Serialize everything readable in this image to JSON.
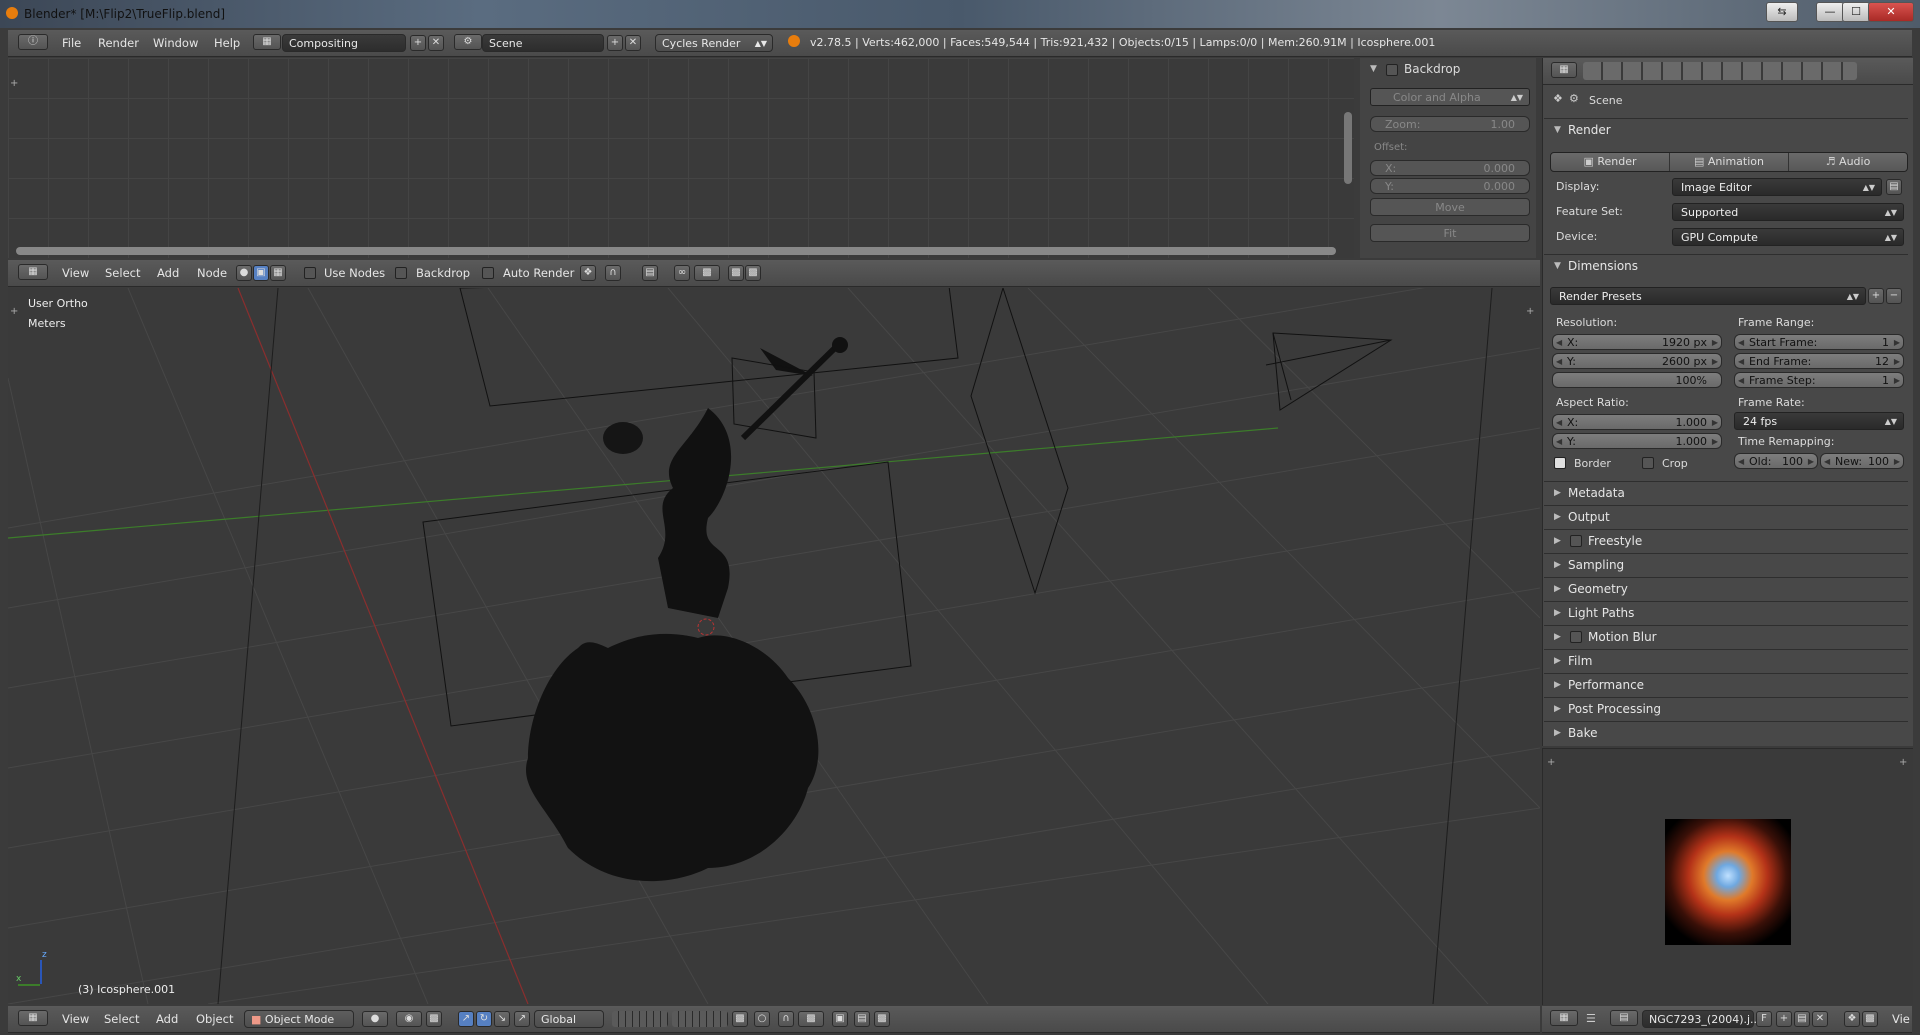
{
  "window": {
    "title": "Blender* [M:\\Flip2\\TrueFlip.blend]",
    "minimize": "—",
    "maximize": "☐",
    "close": "✕",
    "restore": "⇆"
  },
  "info_header": {
    "menus": [
      "File",
      "Render",
      "Window",
      "Help"
    ],
    "screen_layout": "Compositing",
    "scene": "Scene",
    "engine": "Cycles Render",
    "stats": "v2.78.5 | Verts:462,000 | Faces:549,544 | Tris:921,432 | Objects:0/15 | Lamps:0/0 | Mem:260.91M | Icosphere.001"
  },
  "node_sidebar": {
    "backdrop_title": "Backdrop",
    "channels": "Color and Alpha",
    "zoom_label": "Zoom:",
    "zoom_value": "1.00",
    "offset_label": "Offset:",
    "x_label": "X:",
    "x_value": "0.000",
    "y_label": "Y:",
    "y_value": "0.000",
    "move": "Move",
    "fit": "Fit"
  },
  "node_header": {
    "menus": [
      "View",
      "Select",
      "Add",
      "Node"
    ],
    "use_nodes": "Use Nodes",
    "backdrop": "Backdrop",
    "auto_render": "Auto Render"
  },
  "viewport": {
    "view_name": "User Ortho",
    "units": "Meters",
    "active_object": "(3) Icosphere.001",
    "axis_x": "x",
    "axis_z": "z"
  },
  "viewport_header": {
    "menus": [
      "View",
      "Select",
      "Add",
      "Object"
    ],
    "mode": "Object Mode",
    "orientation": "Global"
  },
  "properties": {
    "context": "Scene",
    "render_panel": "Render",
    "render_btn": "Render",
    "animation_btn": "Animation",
    "audio_btn": "Audio",
    "display_label": "Display:",
    "display_value": "Image Editor",
    "feature_label": "Feature Set:",
    "feature_value": "Supported",
    "device_label": "Device:",
    "device_value": "GPU Compute",
    "dimensions_panel": "Dimensions",
    "render_presets": "Render Presets",
    "resolution_label": "Resolution:",
    "res_x_label": "X:",
    "res_x": "1920 px",
    "res_y_label": "Y:",
    "res_y": "2600 px",
    "res_pct": "100%",
    "frame_range_label": "Frame Range:",
    "start_label": "Start Frame:",
    "start": "1",
    "end_label": "End Frame:",
    "end": "12",
    "step_label": "Frame Step:",
    "step": "1",
    "aspect_label": "Aspect Ratio:",
    "asp_x_label": "X:",
    "asp_x": "1.000",
    "asp_y_label": "Y:",
    "asp_y": "1.000",
    "frame_rate_label": "Frame Rate:",
    "frame_rate": "24 fps",
    "time_remap_label": "Time Remapping:",
    "old_label": "Old:",
    "old": "100",
    "new_label": "New:",
    "new": "100",
    "border": "Border",
    "crop": "Crop",
    "sections": [
      "Metadata",
      "Output",
      "Freestyle",
      "Sampling",
      "Geometry",
      "Light Paths",
      "Motion Blur",
      "Film",
      "Performance",
      "Post Processing",
      "Bake"
    ]
  },
  "image_editor": {
    "image_name": "NGC7293_(2004).j...",
    "fake_user": "F",
    "view_label": "Vie"
  },
  "colors": {
    "accent_blue": "#5680c2",
    "grid_x": "#8a2e2e",
    "grid_y": "#3c7d2a",
    "viewport_bg": "#3a3a3a"
  }
}
